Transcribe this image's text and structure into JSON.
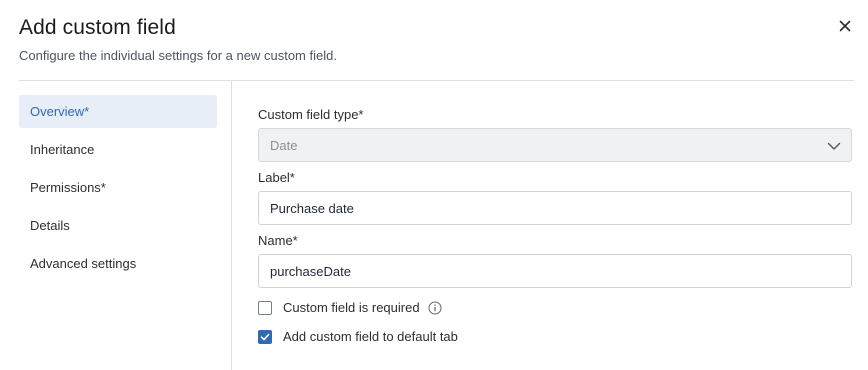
{
  "dialog": {
    "title": "Add custom field",
    "subtitle": "Configure the individual settings for a new custom field."
  },
  "sidebar": {
    "items": [
      {
        "label": "Overview*",
        "active": true
      },
      {
        "label": "Inheritance",
        "active": false
      },
      {
        "label": "Permissions*",
        "active": false
      },
      {
        "label": "Details",
        "active": false
      },
      {
        "label": "Advanced settings",
        "active": false
      }
    ]
  },
  "form": {
    "type": {
      "label": "Custom field type*",
      "value": "Date"
    },
    "label_field": {
      "label": "Label*",
      "value": "Purchase date"
    },
    "name_field": {
      "label": "Name*",
      "value": "purchaseDate"
    },
    "required_checkbox": {
      "label": "Custom field is required",
      "checked": false
    },
    "default_tab_checkbox": {
      "label": "Add custom field to default tab",
      "checked": true
    }
  },
  "colors": {
    "accent": "#2f6ab5",
    "active_nav_bg": "#e7eef8",
    "divider": "#dcdfe3"
  },
  "icons": {
    "close": "close-icon",
    "chevron": "chevron-down-icon",
    "info": "info-icon",
    "check": "checkmark-icon"
  }
}
